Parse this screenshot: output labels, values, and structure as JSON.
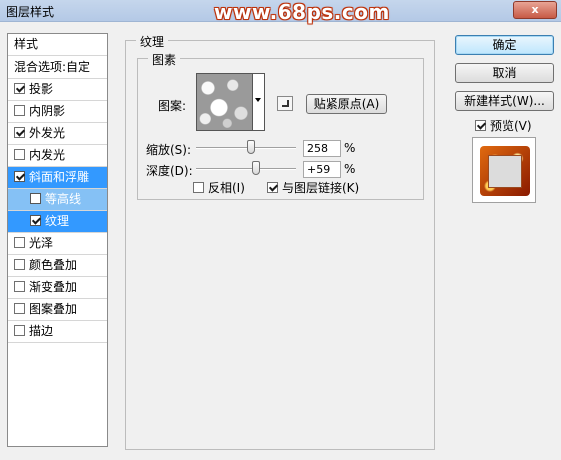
{
  "window": {
    "title": "图层样式",
    "watermark": "www.68ps.com",
    "close_label": "x"
  },
  "style_list": {
    "header": "样式",
    "blend_options": "混合选项:自定",
    "items": [
      {
        "label": "投影",
        "checked": true
      },
      {
        "label": "内阴影",
        "checked": false
      },
      {
        "label": "外发光",
        "checked": true
      },
      {
        "label": "内发光",
        "checked": false
      },
      {
        "label": "斜面和浮雕",
        "checked": true
      },
      {
        "label": "等高线",
        "checked": false
      },
      {
        "label": "纹理",
        "checked": true
      },
      {
        "label": "光泽",
        "checked": false
      },
      {
        "label": "颜色叠加",
        "checked": false
      },
      {
        "label": "渐变叠加",
        "checked": false
      },
      {
        "label": "图案叠加",
        "checked": false
      },
      {
        "label": "描边",
        "checked": false
      }
    ]
  },
  "texture_panel": {
    "group_title": "纹理",
    "subgroup_title": "图素",
    "pattern_label": "图案:",
    "snap_origin_button": "贴紧原点(A)",
    "scale_label": "缩放(S):",
    "scale_value": "258",
    "scale_unit": "%",
    "scale_fraction": 0.55,
    "depth_label": "深度(D):",
    "depth_value": "+59",
    "depth_unit": "%",
    "depth_fraction": 0.6,
    "invert_label": "反相(I)",
    "invert_checked": false,
    "link_label": "与图层链接(K)",
    "link_checked": true
  },
  "right_panel": {
    "ok_button": "确定",
    "cancel_button": "取消",
    "new_style_button": "新建样式(W)...",
    "preview_label": "预览(V)",
    "preview_checked": true
  }
}
